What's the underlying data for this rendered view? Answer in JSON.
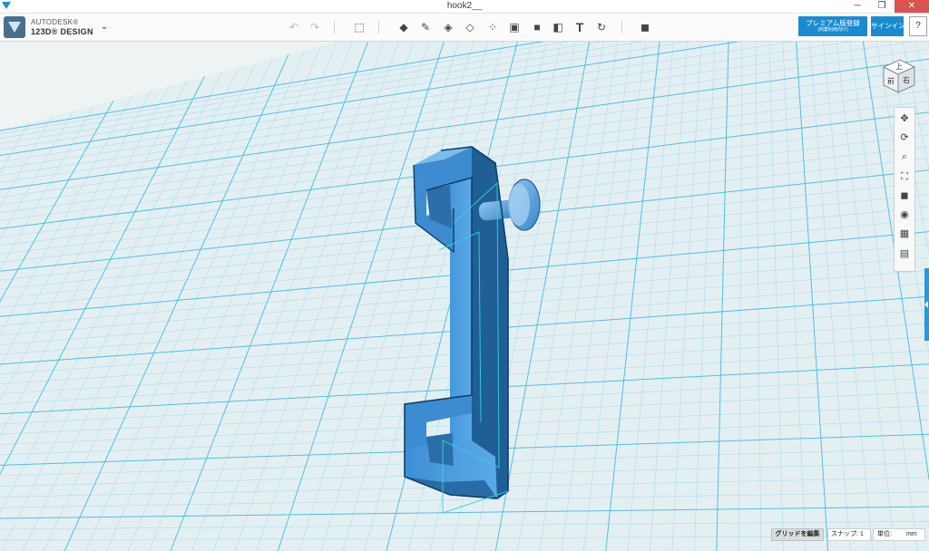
{
  "window": {
    "title": "hook2__",
    "minimize_glyph": "─",
    "maximize_glyph": "❐",
    "close_glyph": "✕"
  },
  "brand": {
    "line1": "AUTODESK®",
    "line2": "123D® DESIGN",
    "menu_glyph": "⌄"
  },
  "toolbar": {
    "undo_glyph": "↶",
    "redo_glyph": "↷",
    "tools": [
      {
        "name": "add-shape-icon",
        "glyph": "⬚"
      },
      {
        "name": "primitives-icon",
        "glyph": "◆"
      },
      {
        "name": "sketch-icon",
        "glyph": "✎"
      },
      {
        "name": "construct-icon",
        "glyph": "◈"
      },
      {
        "name": "modify-icon",
        "glyph": "◇"
      },
      {
        "name": "pattern-icon",
        "glyph": "⁘"
      },
      {
        "name": "group-icon",
        "glyph": "▣"
      },
      {
        "name": "combine-icon",
        "glyph": "■"
      },
      {
        "name": "measure-icon",
        "glyph": "◧"
      },
      {
        "name": "text-icon",
        "glyph": "T"
      },
      {
        "name": "snap-icon",
        "glyph": "↻"
      },
      {
        "name": "material-icon",
        "glyph": "◼"
      }
    ],
    "premium_line1": "プレミアム版登録",
    "premium_line2": "(商業利用向け)",
    "signin_label": "サインイン",
    "help_label": "?"
  },
  "viewcube": {
    "top_label": "上",
    "front_label": "前",
    "right_label": "右"
  },
  "navbar": {
    "items": [
      {
        "name": "pan-icon",
        "glyph": "✥"
      },
      {
        "name": "orbit-icon",
        "glyph": "⟳"
      },
      {
        "name": "zoom-icon",
        "glyph": "⌕"
      },
      {
        "name": "fit-icon",
        "glyph": "⛶"
      },
      {
        "name": "view-cube-icon",
        "glyph": "◼"
      },
      {
        "name": "visibility-icon",
        "glyph": "◉"
      },
      {
        "name": "grid-view-icon",
        "glyph": "▦"
      },
      {
        "name": "materials-icon",
        "glyph": "▤"
      }
    ]
  },
  "statusbar": {
    "edit_grid_label": "グリッドを編集",
    "snap_label": "スナップ:",
    "snap_value": "1",
    "unit_label": "単位:",
    "unit_value": "mm"
  },
  "colors": {
    "accent": "#1b8bd1",
    "grid_line": "#7fd0ea",
    "model_fill": "#4f9fe0",
    "model_dark": "#1f5f96"
  }
}
